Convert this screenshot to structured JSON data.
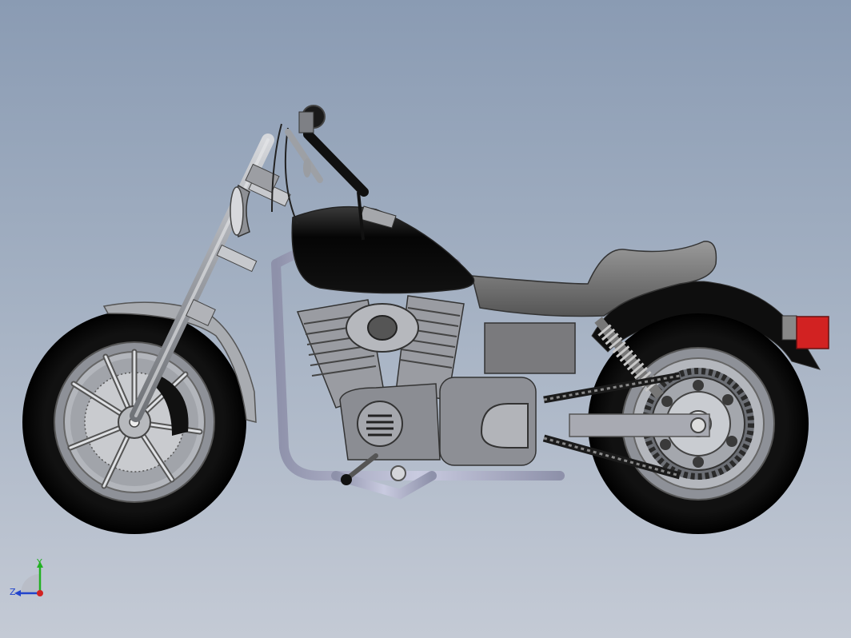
{
  "viewport": {
    "background_top": "#8a9bb3",
    "background_bottom": "#c4cad5"
  },
  "model": {
    "name": "motorcycle",
    "view": "right side",
    "colors": {
      "tire": "#0a0a0a",
      "tank": "#080808",
      "chrome": "#a9acb1",
      "frame": "#aeb1c8",
      "seat": "#6d6d6d",
      "taillight": "#d22222"
    }
  },
  "triad": {
    "y_label": "Y",
    "z_label": "Z",
    "y_color": "#22b022",
    "x_color": "#d22222",
    "z_color": "#2244cc"
  }
}
